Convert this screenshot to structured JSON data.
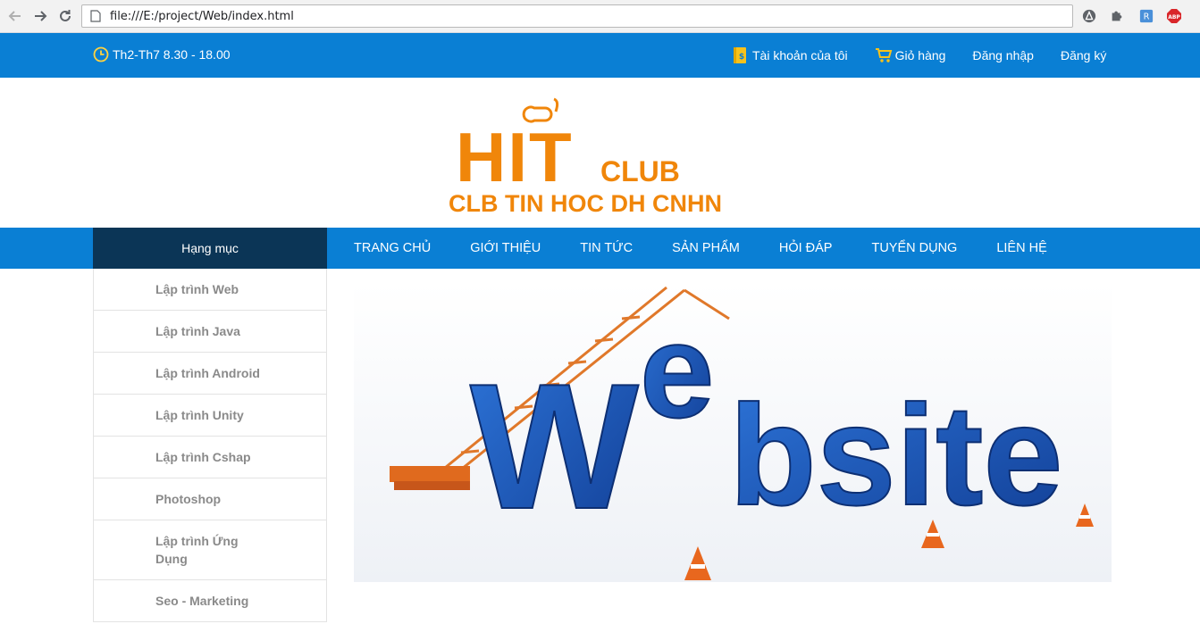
{
  "browser": {
    "url": "file:///E:/project/Web/index.html"
  },
  "topbar": {
    "hours": "Th2-Th7 8.30 - 18.00",
    "links": [
      {
        "label": "Tài khoản của tôi",
        "icon": "account-book-icon"
      },
      {
        "label": "Giỏ hàng",
        "icon": "cart-icon"
      },
      {
        "label": "Đăng nhập"
      },
      {
        "label": "Đăng ký"
      }
    ]
  },
  "logo": {
    "brand": "HIT",
    "club": "CLUB",
    "tagline": "CLB TIN HOC DH CNHN"
  },
  "nav": {
    "category_heading": "Hạng mục",
    "items": [
      "TRANG CHỦ",
      "GIỚI THIỆU",
      "TIN TỨC",
      "SẢN PHẨM",
      "HỎI ĐÁP",
      "TUYỂN DỤNG",
      "LIÊN HỆ"
    ]
  },
  "sidebar": {
    "items": [
      "Lập trình Web",
      "Lập trình Java",
      "Lập trình Android",
      "Lập trình Unity",
      "Lập trình Cshap",
      "Photoshop",
      "Lập trình Ứng Dụng",
      "Seo - Marketing"
    ]
  },
  "banner": {
    "text": "Website"
  },
  "colors": {
    "primary_blue": "#0a7fd4",
    "category_dark": "#0b3556",
    "logo_orange": "#f0860a",
    "banner_blue": "#1a5fc4"
  }
}
